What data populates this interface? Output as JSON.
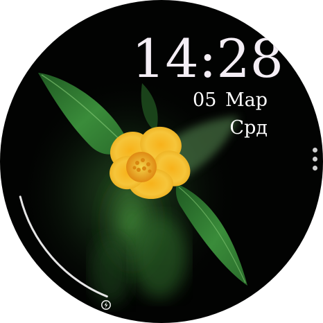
{
  "watchface": {
    "time": "14:28",
    "date": "05 Мар",
    "weekday": "Срд",
    "battery_level": 0.15,
    "colors": {
      "text": "#ffffff",
      "time_text": "#f4eef5",
      "background": "#020302",
      "battery_arc": "#e6e6e6",
      "flower_petal": "#f3b722",
      "leaf": "#2f7a32"
    },
    "icons": [
      "battery-charging-icon",
      "menu-dots-icon"
    ]
  }
}
